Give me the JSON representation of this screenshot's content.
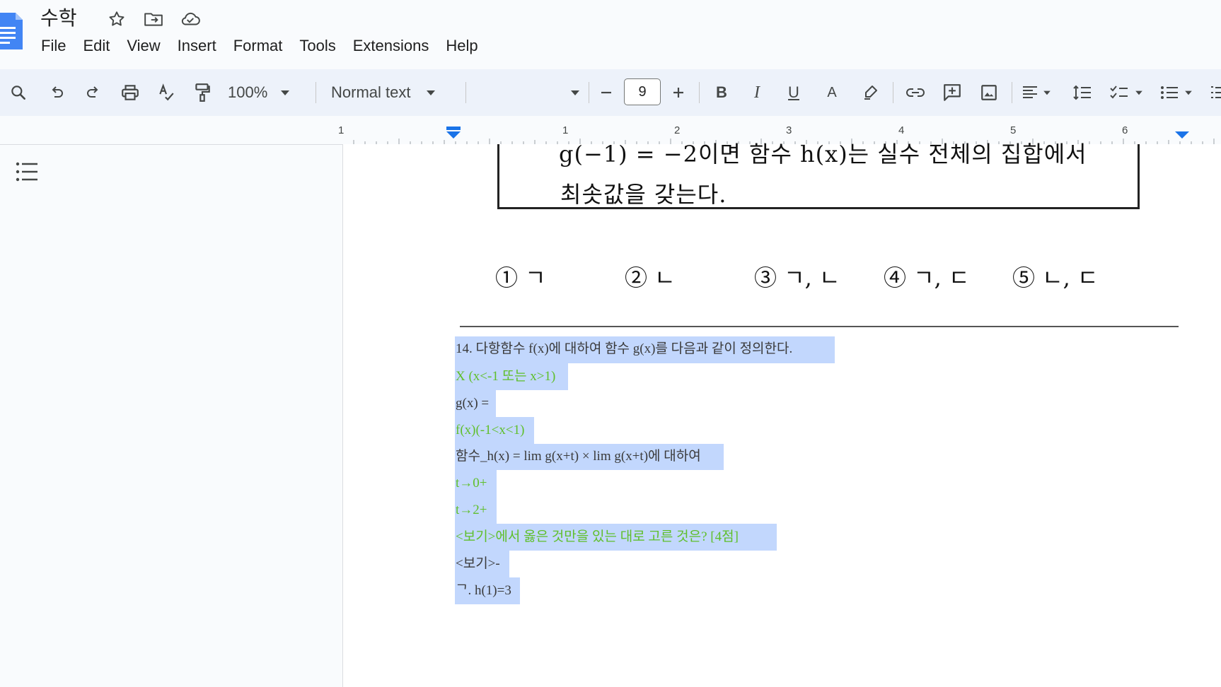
{
  "document": {
    "title": "수학"
  },
  "menu": [
    "File",
    "Edit",
    "View",
    "Insert",
    "Format",
    "Tools",
    "Extensions",
    "Help"
  ],
  "toolbar": {
    "zoom": "100%",
    "paragraph_style": "Normal text",
    "font_size": "9",
    "bold_label": "B",
    "italic_label": "I",
    "underline_label": "U",
    "text_color_label": "A"
  },
  "ruler": {
    "labels": [
      "1",
      "1",
      "2",
      "3",
      "4",
      "5",
      "6"
    ]
  },
  "content": {
    "image_text": {
      "line1": "g(−1) = −2이면 함수 h(x)는 실수 전체의 집합에서",
      "line2": "최솟값을 갖는다.",
      "choices": [
        "① ㄱ",
        "② ㄴ",
        "③ ㄱ, ㄴ",
        "④ ㄱ, ㄷ",
        "⑤ ㄴ, ㄷ"
      ]
    },
    "lines": [
      {
        "text": "14. 다항함수 f(x)에 대하여 함수 g(x)를 다음과 같이 정의한다.",
        "color": "#3a3a3a"
      },
      {
        "text": "X (x<-1 또는 x>1)",
        "color": "#5fbf2a"
      },
      {
        "text": "g(x) =",
        "color": "#3a3a3a"
      },
      {
        "text": "f(x)(-1<x<1)",
        "color": "#5fbf2a"
      },
      {
        "text": "함수_h(x) = lim g(x+t) × lim g(x+t)에 대하여",
        "color": "#3a3a3a"
      },
      {
        "text": "t→0+",
        "color": "#5fbf2a"
      },
      {
        "text": "t→2+",
        "color": "#5fbf2a"
      },
      {
        "text": "<보기>에서 옳은 것만을 있는 대로 고른 것은? [4점]",
        "color": "#5fbf2a"
      },
      {
        "text": "<보기>-",
        "color": "#3a3a3a"
      },
      {
        "text": "ᄀ. h(1)=3",
        "color": "#3a3a3a"
      }
    ]
  },
  "colors": {
    "selection": "#c2d7fd",
    "accent": "#1a73e8",
    "toolbar_bg": "#edf2fa"
  }
}
